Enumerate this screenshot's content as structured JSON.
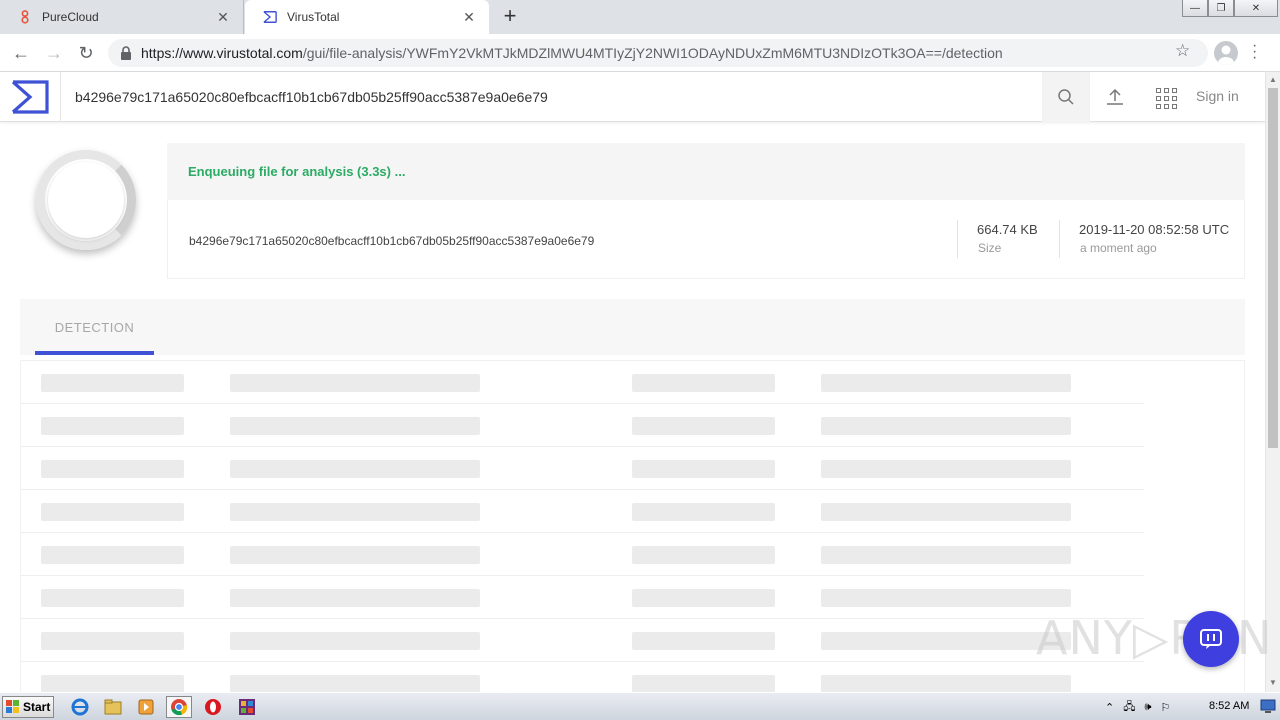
{
  "browser": {
    "tabs": [
      {
        "title": "PureCloud",
        "active": false
      },
      {
        "title": "VirusTotal",
        "active": true
      }
    ],
    "url_host": "https://www.virustotal.com",
    "url_path": "/gui/file-analysis/YWFmY2VkMTJkMDZlMWU4MTIyZjY2NWI1ODAyNDUxZmM6MTU3NDIzOTk3OA==/detection"
  },
  "vt": {
    "search_value": "b4296e79c171a65020c80efbcacff10b1cb67db05b25ff90acc5387e9a0e6e79",
    "signin_label": "Sign in",
    "status_text": "Enqueuing file for analysis (3.3s) ...",
    "file_hash": "b4296e79c171a65020c80efbcacff10b1cb67db05b25ff90acc5387e9a0e6e79",
    "size_value": "664.74 KB",
    "size_label": "Size",
    "date_value": "2019-11-20 08:52:58 UTC",
    "date_label": "a moment ago",
    "tab_detection": "DETECTION",
    "accent_color": "#3f51d4",
    "status_color": "#2bab64"
  },
  "watermark": {
    "text": "ANY▷RUN"
  },
  "taskbar": {
    "start_label": "Start",
    "clock": "8:52 AM"
  }
}
